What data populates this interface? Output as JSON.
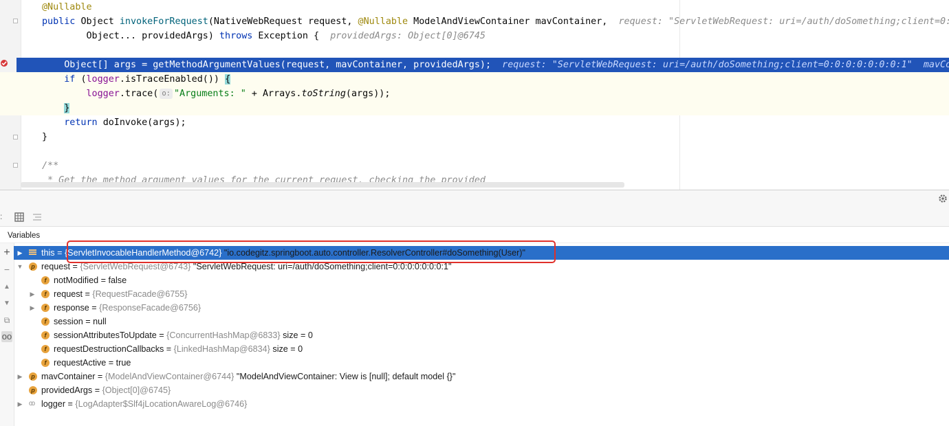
{
  "editor": {
    "lines": [
      {
        "segments": [
          {
            "t": "@Nullable",
            "c": "ann"
          }
        ]
      },
      {
        "segments": [
          {
            "t": "public ",
            "c": "kw"
          },
          {
            "t": "Object "
          },
          {
            "t": "invokeForRequest",
            "c": "fn"
          },
          {
            "t": "(NativeWebRequest request, "
          },
          {
            "t": "@Nullable",
            "c": "ann"
          },
          {
            "t": " ModelAndViewContainer mavContainer,  "
          },
          {
            "t": "request: \"ServletWebRequest: uri=/auth/doSomething;client=0:0",
            "c": "hint"
          }
        ]
      },
      {
        "segments": [
          {
            "t": "        Object... providedArgs) "
          },
          {
            "t": "throws ",
            "c": "kw"
          },
          {
            "t": "Exception {  "
          },
          {
            "t": "providedArgs: Object[0]@6745",
            "c": "hint"
          }
        ]
      },
      {
        "segments": []
      },
      {
        "segments": [
          {
            "t": "    Object[] args = getMethodArgumentValues(request, mavContainer, providedArgs);  "
          },
          {
            "t": "request: \"ServletWebRequest: uri=/auth/doSomething;client=0:0:0:0:0:0:0:1\"  mavCon",
            "c": "hint-w"
          }
        ]
      },
      {
        "segments": [
          {
            "t": "    "
          },
          {
            "t": "if ",
            "c": "kw"
          },
          {
            "t": "("
          },
          {
            "t": "logger",
            "c": "fld"
          },
          {
            "t": ".isTraceEnabled()) "
          },
          {
            "t": "{",
            "c": "brace-hl"
          }
        ]
      },
      {
        "segments": [
          {
            "t": "        "
          },
          {
            "t": "logger",
            "c": "fld"
          },
          {
            "t": ".trace("
          },
          {
            "t": "o:",
            "c": "inlay"
          },
          {
            "t": "\"Arguments: \"",
            "c": "str"
          },
          {
            "t": " + Arrays."
          },
          {
            "t": "toString",
            "c": "it"
          },
          {
            "t": "(args));"
          }
        ]
      },
      {
        "segments": [
          {
            "t": "    "
          },
          {
            "t": "}",
            "c": "brace-hl"
          }
        ]
      },
      {
        "segments": [
          {
            "t": "    "
          },
          {
            "t": "return ",
            "c": "kw"
          },
          {
            "t": "doInvoke(args);"
          }
        ]
      },
      {
        "segments": [
          {
            "t": "}"
          }
        ]
      },
      {
        "segments": []
      },
      {
        "segments": [
          {
            "t": "/**",
            "c": "cmt"
          }
        ]
      },
      {
        "segments": [
          {
            "t": " * Get the method argument values for the current request, checking the provided",
            "c": "cmt"
          }
        ]
      }
    ]
  },
  "debugger": {
    "panel_title": "Variables",
    "rows": [
      {
        "indent": 0,
        "arrow": "▶",
        "icon": "lines",
        "name": "this",
        "type": "{ServletInvocableHandlerMethod@6742}",
        "value": "\"io.codegitz.springboot.auto.controller.ResolverController#doSomething(User)\"",
        "selected": true
      },
      {
        "indent": 0,
        "arrow": "▼",
        "icon": "p",
        "name": "request",
        "type": "{ServletWebRequest@6743}",
        "value": "\"ServletWebRequest: uri=/auth/doSomething;client=0:0:0:0:0:0:0:1\""
      },
      {
        "indent": 1,
        "arrow": "",
        "icon": "f",
        "name": "notModified",
        "type": "",
        "value": "false"
      },
      {
        "indent": 1,
        "arrow": "▶",
        "icon": "f",
        "name": "request",
        "type": "{RequestFacade@6755}",
        "value": ""
      },
      {
        "indent": 1,
        "arrow": "▶",
        "icon": "f",
        "name": "response",
        "type": "{ResponseFacade@6756}",
        "value": ""
      },
      {
        "indent": 1,
        "arrow": "",
        "icon": "f",
        "name": "session",
        "type": "",
        "value": "null"
      },
      {
        "indent": 1,
        "arrow": "",
        "icon": "f",
        "name": "sessionAttributesToUpdate",
        "type": "{ConcurrentHashMap@6833}",
        "value": " size = 0"
      },
      {
        "indent": 1,
        "arrow": "",
        "icon": "f",
        "name": "requestDestructionCallbacks",
        "type": "{LinkedHashMap@6834}",
        "value": " size = 0"
      },
      {
        "indent": 1,
        "arrow": "",
        "icon": "f",
        "name": "requestActive",
        "type": "",
        "value": "true"
      },
      {
        "indent": 0,
        "arrow": "▶",
        "icon": "p",
        "name": "mavContainer",
        "type": "{ModelAndViewContainer@6744}",
        "value": "\"ModelAndViewContainer: View is [null]; default model {}\""
      },
      {
        "indent": 0,
        "arrow": "",
        "icon": "p",
        "name": "providedArgs",
        "type": "{Object[0]@6745}",
        "value": ""
      },
      {
        "indent": 0,
        "arrow": "▶",
        "icon": "oo",
        "name": "logger",
        "type": "{LogAdapter$Slf4jLocationAwareLog@6746}",
        "value": ""
      }
    ]
  },
  "colors": {
    "selection": "#2a6fc9",
    "exec_line": "#2154b8",
    "annotation_box": "#e0302a"
  }
}
